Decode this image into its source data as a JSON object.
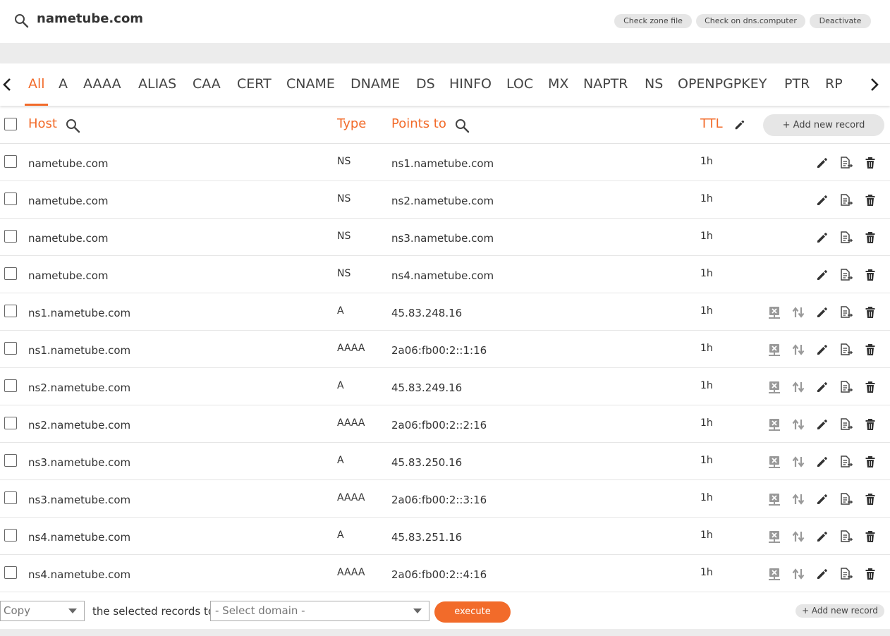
{
  "header": {
    "domain": "nametube.com",
    "buttons": [
      "Check zone file",
      "Check on dns.computer",
      "Deactivate"
    ]
  },
  "tabs": [
    "All",
    "A",
    "AAAA",
    "ALIAS",
    "CAA",
    "CERT",
    "CNAME",
    "DNAME",
    "DS",
    "HINFO",
    "LOC",
    "MX",
    "NAPTR",
    "NS",
    "OPENPGPKEY",
    "PTR",
    "RP"
  ],
  "active_tab": "All",
  "table": {
    "columns": {
      "host": "Host",
      "type": "Type",
      "points_to": "Points to",
      "ttl": "TTL"
    },
    "add_record_label": "+ Add new record",
    "rows": [
      {
        "host": "nametube.com",
        "type": "NS",
        "points_to": "ns1.nametube.com",
        "ttl": "1h",
        "extra_actions": false
      },
      {
        "host": "nametube.com",
        "type": "NS",
        "points_to": "ns2.nametube.com",
        "ttl": "1h",
        "extra_actions": false
      },
      {
        "host": "nametube.com",
        "type": "NS",
        "points_to": "ns3.nametube.com",
        "ttl": "1h",
        "extra_actions": false
      },
      {
        "host": "nametube.com",
        "type": "NS",
        "points_to": "ns4.nametube.com",
        "ttl": "1h",
        "extra_actions": false
      },
      {
        "host": "ns1.nametube.com",
        "type": "A",
        "points_to": "45.83.248.16",
        "ttl": "1h",
        "extra_actions": true
      },
      {
        "host": "ns1.nametube.com",
        "type": "AAAA",
        "points_to": "2a06:fb00:2::1:16",
        "ttl": "1h",
        "extra_actions": true
      },
      {
        "host": "ns2.nametube.com",
        "type": "A",
        "points_to": "45.83.249.16",
        "ttl": "1h",
        "extra_actions": true
      },
      {
        "host": "ns2.nametube.com",
        "type": "AAAA",
        "points_to": "2a06:fb00:2::2:16",
        "ttl": "1h",
        "extra_actions": true
      },
      {
        "host": "ns3.nametube.com",
        "type": "A",
        "points_to": "45.83.250.16",
        "ttl": "1h",
        "extra_actions": true
      },
      {
        "host": "ns3.nametube.com",
        "type": "AAAA",
        "points_to": "2a06:fb00:2::3:16",
        "ttl": "1h",
        "extra_actions": true
      },
      {
        "host": "ns4.nametube.com",
        "type": "A",
        "points_to": "45.83.251.16",
        "ttl": "1h",
        "extra_actions": true
      },
      {
        "host": "ns4.nametube.com",
        "type": "AAAA",
        "points_to": "2a06:fb00:2::4:16",
        "ttl": "1h",
        "extra_actions": true
      }
    ]
  },
  "footer": {
    "action_select": "Copy",
    "middle_text": "the selected records to",
    "domain_select": "- Select domain -",
    "execute_label": "execute",
    "add_record_label": "+ Add new record"
  },
  "colors": {
    "accent": "#f26b2a",
    "button_grey": "#e6e6e6",
    "band_grey": "#ececec"
  }
}
